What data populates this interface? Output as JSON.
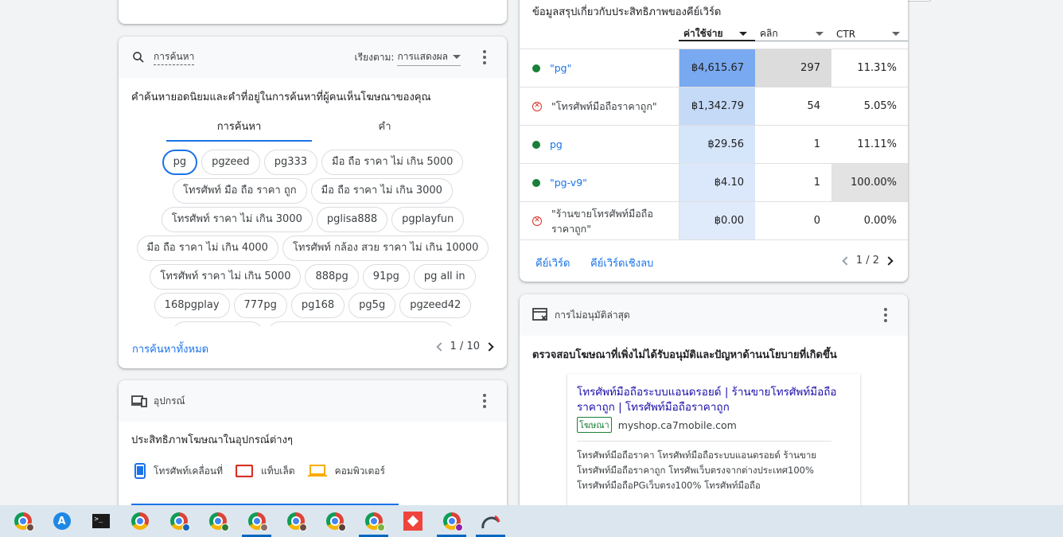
{
  "search_card": {
    "title": "การค้นหา",
    "sort_label": "เรียงตาม:",
    "sort_value": "การแสดงผล",
    "description": "คำค้นหายอดนิยมและคำที่อยู่ในการค้นหาที่ผู้คนเห็นโฆษณาของคุณ",
    "tabs": [
      "การค้นหา",
      "คำ"
    ],
    "chips": [
      "pg",
      "pgzeed",
      "pg333",
      "มือ ถือ ราคา ไม่ เกิน 5000",
      "โทรศัพท์ มือ ถือ ราคา ถูก",
      "มือ ถือ ราคา ไม่ เกิน 3000",
      "โทรศัพท์ ราคา ไม่ เกิน 3000",
      "pglisa888",
      "pgplayfun",
      "มือ ถือ ราคา ไม่ เกิน 4000",
      "โทรศัพท์ กล้อง สวย ราคา ไม่ เกิน 10000",
      "โทรศัพท์ ราคา ไม่ เกิน 5000",
      "888pg",
      "91pg",
      "pg all in",
      "168pgplay",
      "777pg",
      "pg168",
      "pg5g",
      "pgzeed42"
    ],
    "all_link": "การค้นหาทั้งหมด",
    "pagination": "1 / 10"
  },
  "device_card": {
    "title": "อุปกรณ์",
    "description": "ประสิทธิภาพโฆษณาในอุปกรณ์ต่างๆ",
    "legend": [
      {
        "label": "โทรศัพท์เคลื่อนที่",
        "color": "#1a73e8"
      },
      {
        "label": "แท็บเล็ต",
        "color": "#d93025"
      },
      {
        "label": "คอมพิวเตอร์",
        "color": "#f9ab00"
      }
    ]
  },
  "keyword_card": {
    "subtitle": "ข้อมูลสรุปเกี่ยวกับประสิทธิภาพของคีย์เวิร์ด",
    "columns": [
      "ค่าใช้จ่าย",
      "คลิก",
      "CTR"
    ],
    "rows": [
      {
        "keyword": "\"pg\"",
        "status": "eligible",
        "cost": "฿4,615.67",
        "clicks": "297",
        "ctr": "11.31%"
      },
      {
        "keyword": "\"โทรศัพท์มือถือราคาถูก\"",
        "status": "not-eligible",
        "cost": "฿1,342.79",
        "clicks": "54",
        "ctr": "5.05%"
      },
      {
        "keyword": "pg",
        "status": "eligible",
        "cost": "฿29.56",
        "clicks": "1",
        "ctr": "11.11%"
      },
      {
        "keyword": "\"pg-v9\"",
        "status": "eligible",
        "cost": "฿4.10",
        "clicks": "1",
        "ctr": "100.00%"
      },
      {
        "keyword": "\"ร้านขายโทรศัพท์มือถือราคาถูก\"",
        "status": "not-eligible",
        "cost": "฿0.00",
        "clicks": "0",
        "ctr": "0.00%"
      }
    ],
    "link_keywords": "คีย์เวิร์ด",
    "link_negative": "คีย์เวิร์ดเชิงลบ",
    "pagination": "1 / 2"
  },
  "disapproval_card": {
    "title": "การไม่อนุมัติล่าสุด",
    "description": "ตรวจสอบโฆษณาที่เพิ่งไม่ได้รับอนุมัติและปัญหาด้านนโยบายที่เกิดขึ้น",
    "ad": {
      "headline": "โทรศัพท์มือถือระบบแอนดรอยด์ | ร้านขายโทรศัพท์มือถือราคาถูก | โทรศัพท์มือถือราคาถูก",
      "ad_label": "โฆษณา",
      "url": "myshop.ca7mobile.com",
      "body": "โทรศัพท์มือถือราคา โทรศัพท์มือถือระบบแอนดรอยด์ ร้านขายโทรศัพท์มือถือราคาถูก โทรศัพเว็บตรงจากต่างประเทศ100% โทรศัพท์มือถือPGเว็บตรง100% โทรศัพท์มือถือ"
    }
  },
  "taskbar": {
    "apps": [
      {
        "icon": "chrome-icon",
        "badge": "#6d4c41"
      },
      {
        "icon": "app-store-icon"
      },
      {
        "icon": "terminal-icon"
      },
      {
        "icon": "chrome-icon"
      },
      {
        "icon": "chrome-icon",
        "badge": "#1565c0"
      },
      {
        "icon": "chrome-icon",
        "badge": "#2e7d32"
      },
      {
        "icon": "chrome-icon",
        "badge": "#8d6e63",
        "active": true
      },
      {
        "icon": "chrome-icon",
        "badge": "#6d4c41"
      },
      {
        "icon": "chrome-icon",
        "badge": "#5d4037"
      },
      {
        "icon": "chrome-icon",
        "badge": "#7cb342",
        "active": true
      },
      {
        "icon": "anydesk-icon"
      },
      {
        "icon": "chrome-icon",
        "badge": "#8e24aa",
        "active": true
      },
      {
        "icon": "gauge-icon",
        "active": true
      }
    ]
  }
}
